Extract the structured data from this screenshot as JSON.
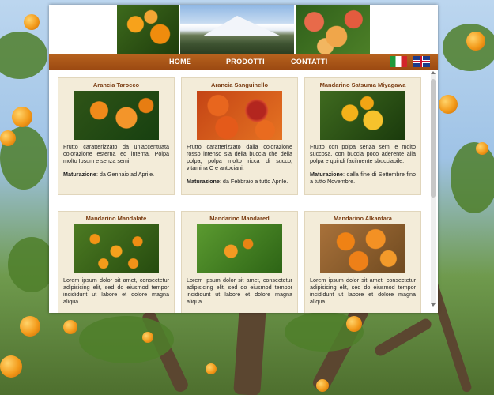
{
  "nav": {
    "home": "HOME",
    "products": "PRODOTTI",
    "contacts": "CONTATTI"
  },
  "flags": {
    "italian": "flag-italy-icon",
    "english": "flag-uk-icon"
  },
  "products": [
    {
      "name": "Arancia Tarocco",
      "description": "Frutto caratterizzato da un'accentuata colorazione esterna ed interna. Polpa molto Ipsum e senza semi.",
      "ripening_label": "Maturazione",
      "ripening": ": da Gennaio ad Aprile."
    },
    {
      "name": "Arancia Sanguinello",
      "description": "Frutto caratterizzato dalla colorazione rosso intenso sia della buccia che della polpa; polpa molto ricca di succo, vitamina C e antociani.",
      "ripening_label": "Maturazione",
      "ripening": ": da Febbraio a tutto Aprile."
    },
    {
      "name": "Mandarino Satsuma Miyagawa",
      "description": "Frutto con polpa senza semi e molto succosa, con buccia poco aderente alla polpa e quindi facilmente sbucciabile.",
      "ripening_label": "Maturazione",
      "ripening": ": dalla fine di Settembre fino a tutto Novembre."
    },
    {
      "name": "Mandarino Mandalate",
      "description": "Lorem ipsum dolor sit amet, consectetur adipisicing elit, sed do eiusmod tempor incididunt ut labore et dolore magna aliqua."
    },
    {
      "name": "Mandarino Mandared",
      "description": "Lorem ipsum dolor sit amet, consectetur adipisicing elit, sed do eiusmod tempor incididunt ut labore et dolore magna aliqua."
    },
    {
      "name": "Mandarino Alkantara",
      "description": "Lorem ipsum dolor sit amet, consectetur adipisicing elit, sed do eiusmod tempor incididunt ut labore et dolore magna aliqua."
    }
  ],
  "colors": {
    "navbar": "#a8561a",
    "card_bg": "#f3ecd9",
    "card_title": "#7a3c12"
  }
}
